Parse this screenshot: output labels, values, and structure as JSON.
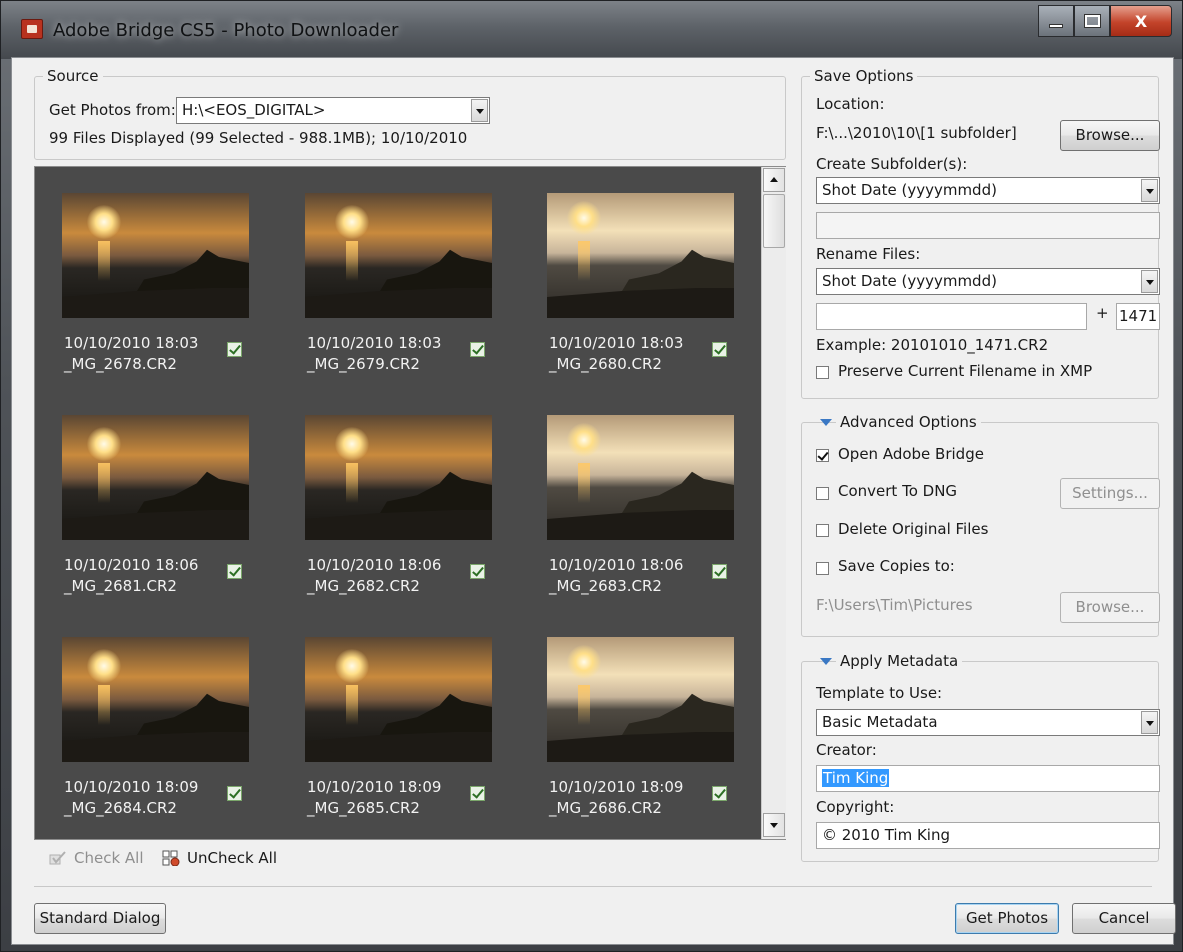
{
  "window": {
    "title": "Adobe Bridge CS5 - Photo Downloader",
    "minimize_glyph": "",
    "maximize_glyph": "",
    "close_glyph": "X"
  },
  "source": {
    "group_label": "Source",
    "get_photos_label": "Get Photos from:",
    "get_photos_value": "H:\\<EOS_DIGITAL>",
    "summary": "99 Files Displayed (99 Selected - 988.1MB); 10/10/2010"
  },
  "thumbnails": [
    {
      "datetime": "10/10/2010 18:03",
      "filename": "_MG_2678.CR2",
      "checked": true
    },
    {
      "datetime": "10/10/2010 18:03",
      "filename": "_MG_2679.CR2",
      "checked": true
    },
    {
      "datetime": "10/10/2010 18:03",
      "filename": "_MG_2680.CR2",
      "checked": true
    },
    {
      "datetime": "10/10/2010 18:06",
      "filename": "_MG_2681.CR2",
      "checked": true
    },
    {
      "datetime": "10/10/2010 18:06",
      "filename": "_MG_2682.CR2",
      "checked": true
    },
    {
      "datetime": "10/10/2010 18:06",
      "filename": "_MG_2683.CR2",
      "checked": true
    },
    {
      "datetime": "10/10/2010 18:09",
      "filename": "_MG_2684.CR2",
      "checked": true
    },
    {
      "datetime": "10/10/2010 18:09",
      "filename": "_MG_2685.CR2",
      "checked": true
    },
    {
      "datetime": "10/10/2010 18:09",
      "filename": "_MG_2686.CR2",
      "checked": true
    }
  ],
  "grid_toolbar": {
    "check_all": "Check All",
    "uncheck_all": "UnCheck All"
  },
  "save_options": {
    "group_label": "Save Options",
    "location_label": "Location:",
    "location_value": "F:\\...\\2010\\10\\[1 subfolder]",
    "browse_label": "Browse...",
    "subfolder_label": "Create Subfolder(s):",
    "subfolder_value": "Shot Date (yyyymmdd)",
    "subfolder_custom": "",
    "rename_label": "Rename Files:",
    "rename_value": "Shot Date (yyyymmdd)",
    "rename_custom": "",
    "plus": "+",
    "sequence": "1471",
    "example": "Example:  20101010_1471.CR2",
    "preserve_label": "Preserve Current Filename in XMP",
    "preserve_checked": false
  },
  "advanced": {
    "group_label": "Advanced Options",
    "open_bridge": "Open Adobe Bridge",
    "open_bridge_checked": true,
    "convert_dng": "Convert To DNG",
    "convert_dng_checked": false,
    "settings_label": "Settings...",
    "delete_originals": "Delete Original Files",
    "delete_originals_checked": false,
    "save_copies": "Save Copies to:",
    "save_copies_checked": false,
    "copies_path": "F:\\Users\\Tim\\Pictures",
    "copies_browse": "Browse..."
  },
  "metadata": {
    "group_label": "Apply Metadata",
    "template_label": "Template to Use:",
    "template_value": "Basic Metadata",
    "creator_label": "Creator:",
    "creator_value": "Tim King",
    "copyright_label": "Copyright:",
    "copyright_value": "© 2010 Tim King"
  },
  "footer": {
    "standard_dialog": "Standard Dialog",
    "get_photos": "Get Photos",
    "cancel": "Cancel"
  },
  "colors": {
    "accent": "#3a78c4",
    "selection": "#3399ff",
    "grid_background": "#4a4a4a"
  }
}
